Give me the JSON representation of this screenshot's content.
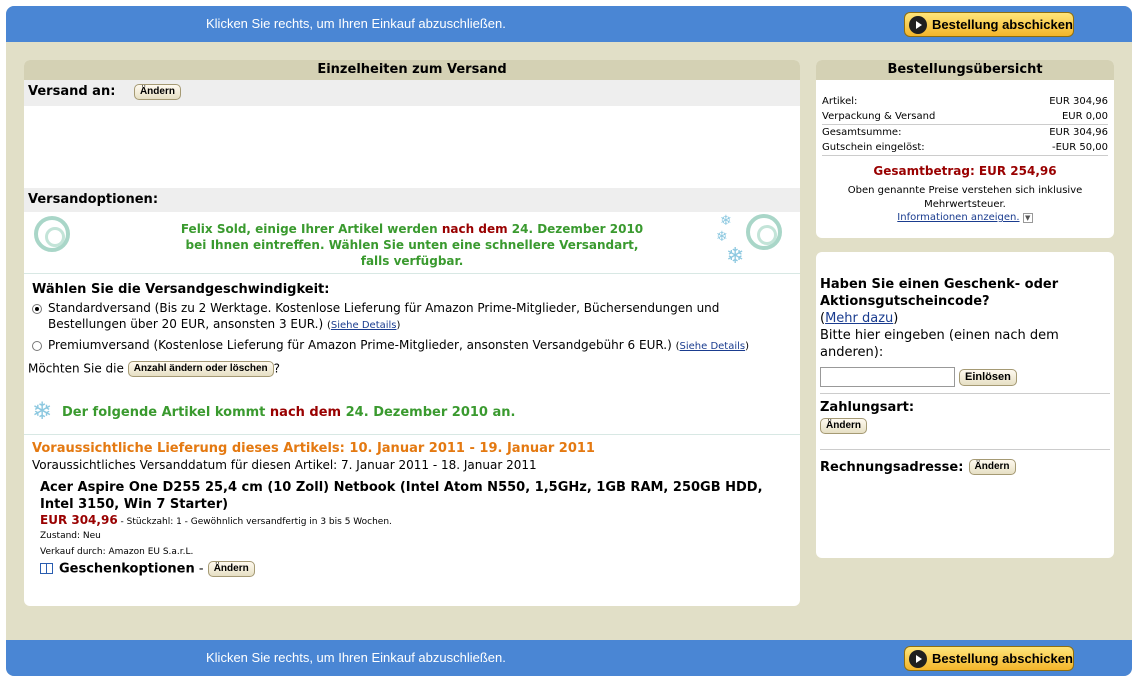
{
  "bar": {
    "text": "Klicken Sie rechts, um Ihren Einkauf abzuschließen.",
    "submit_label": "Bestellung abschicken"
  },
  "shipping": {
    "header": "Einzelheiten zum Versand",
    "ship_to_label": "Versand an:",
    "change_label": "Ändern",
    "options_label": "Versandoptionen:",
    "notice_part1": "Felix Sold, einige Ihrer Artikel werden ",
    "notice_after": "nach dem",
    "notice_date": " 24. Dezember 2010",
    "notice_part2": "bei Ihnen eintreffen. Wählen Sie unten eine schnellere Versandart,",
    "notice_part3": "falls verfügbar.",
    "speed_title": "Wählen Sie die Versandgeschwindigkeit:",
    "option_standard": "Standardversand (Bis zu 2 Werktage. Kostenlose Lieferung für Amazon Prime-Mitglieder, Büchersendungen und Bestellungen über 20 EUR, ansonsten 3 EUR.)",
    "option_premium": "Premiumversand (Kostenlose Lieferung für Amazon Prime-Mitglieder, ansonsten Versandgebühr 6 EUR.)",
    "details_link": "Siehe Details",
    "qty_question_pre": "Möchten Sie die",
    "qty_button": "Anzahl ändern oder löschen",
    "qty_question_post": "?",
    "item_notice_pre": "Der folgende Artikel kommt ",
    "item_notice_after": "nach dem",
    "item_notice_date": " 24. Dezember 2010 an.",
    "delivery_estimate": "Voraussichtliche Lieferung dieses Artikels: 10. Januar 2011 - 19. Januar 2011",
    "ship_date": "Voraussichtliches Versanddatum für diesen Artikel: 7. Januar 2011 - 18. Januar 2011",
    "product_title": "Acer Aspire One D255 25,4 cm (10 Zoll) Netbook (Intel Atom N550, 1,5GHz, 1GB RAM, 250GB HDD, Intel 3150, Win 7 Starter)",
    "product_price": "EUR 304,96",
    "product_qty": " - Stückzahl: 1 - Gewöhnlich versandfertig in 3 bis 5 Wochen.",
    "product_condition": "Zustand: Neu",
    "product_seller": "Verkauf durch: Amazon EU S.a.r.L.",
    "gift_label": "Geschenkoptionen",
    "gift_sep": " - "
  },
  "summary": {
    "header": "Bestellungsübersicht",
    "rows": [
      {
        "label": "Artikel:",
        "value": "EUR 304,96"
      },
      {
        "label": "Verpackung & Versand",
        "value": "EUR 0,00"
      },
      {
        "label": "Gesamtsumme:",
        "value": "EUR 304,96"
      },
      {
        "label": "Gutschein eingelöst:",
        "value": "-EUR 50,00"
      }
    ],
    "total": "Gesamtbetrag: EUR 254,96",
    "tax_note": "Oben genannte Preise verstehen sich inklusive Mehrwertsteuer.",
    "info_link": "Informationen anzeigen."
  },
  "voucher": {
    "title": "Haben Sie einen Geschenk- oder Aktionsgutscheincode?",
    "more_pre": "(",
    "more_link": "Mehr dazu",
    "more_post": ")",
    "hint": "Bitte hier eingeben (einen nach dem anderen):",
    "input_value": "",
    "redeem_button": "Einlösen",
    "payment_label": "Zahlungsart:",
    "billing_label": "Rechnungsadresse:",
    "change_label": "Ändern"
  },
  "colors": {
    "bar": "#4a86d4",
    "frame": "#e1dfc7",
    "green": "#3a9a2f",
    "red": "#990000",
    "orange": "#e47911",
    "link": "#1a3c8f"
  }
}
